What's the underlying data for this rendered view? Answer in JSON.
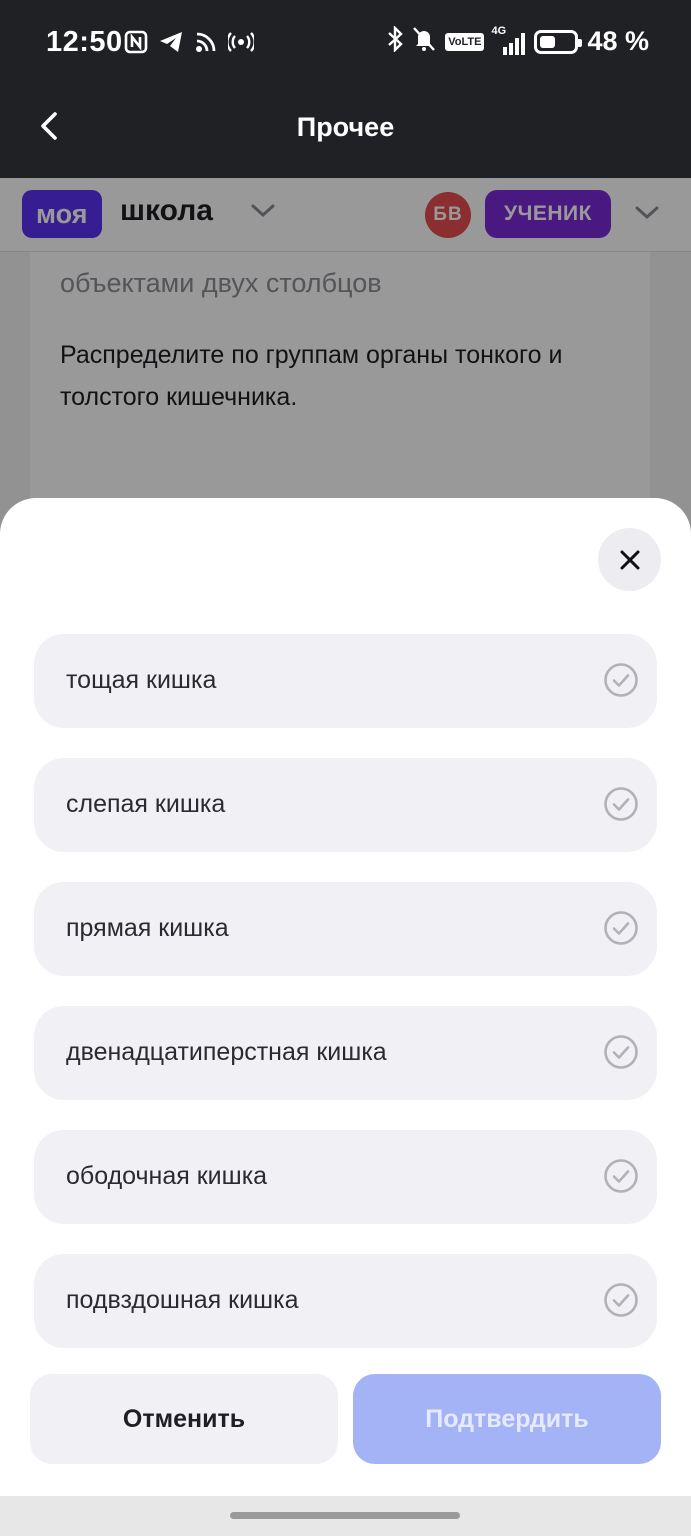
{
  "status_bar": {
    "time": "12:50",
    "battery": "48 %",
    "battery_level": 0.48,
    "network_badge": "VoLTE",
    "network_type": "4G",
    "icons": [
      "nfc-icon",
      "telegram-icon",
      "cast-icon",
      "hotspot-icon",
      "bluetooth-icon",
      "muted-bell-icon",
      "signal-icon",
      "battery-icon"
    ]
  },
  "header": {
    "title": "Прочее",
    "back_icon": "chevron-left-icon"
  },
  "site": {
    "logo_part1": "моя",
    "logo_part2": "школа",
    "avatar_initials": "БВ",
    "role": "УЧЕНИК",
    "brand_color": "#5a31f4",
    "role_color": "#7a2bd8",
    "avatar_color": "#e84e50"
  },
  "task": {
    "hint": "объектами двух столбцов",
    "question": "Распределите по группам органы тонкого и толстого кишечника."
  },
  "sheet": {
    "close_icon": "close-icon",
    "options": [
      {
        "label": "тощая кишка"
      },
      {
        "label": "слепая кишка"
      },
      {
        "label": "прямая кишка"
      },
      {
        "label": "двенадцатиперстная кишка"
      },
      {
        "label": "ободочная кишка"
      },
      {
        "label": "подвздошная кишка"
      }
    ],
    "cancel_label": "Отменить",
    "confirm_label": "Подтвердить",
    "confirm_color": "#a4b2f6"
  }
}
